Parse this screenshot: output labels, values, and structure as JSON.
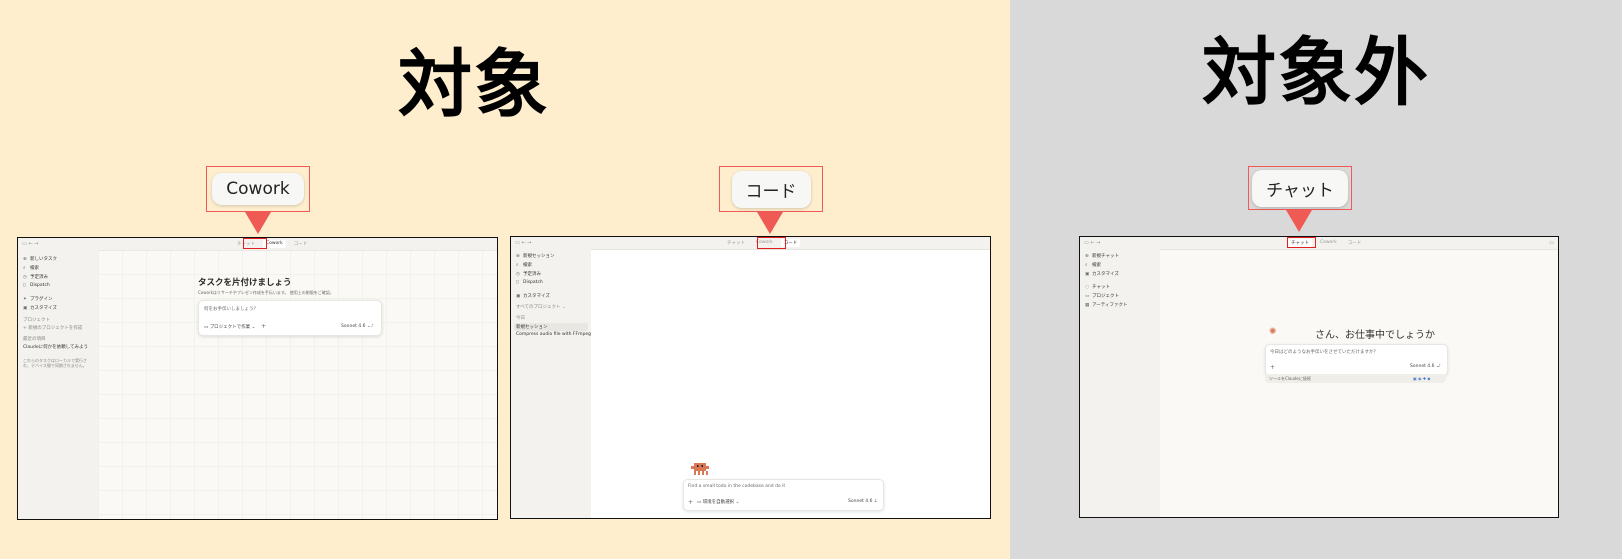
{
  "left_panel": {
    "title": "対象",
    "bg_color": "#FEEECE"
  },
  "right_panel": {
    "title": "対象外",
    "bg_color": "#D9D9D9"
  },
  "accent_color": "#F05A55",
  "tags": {
    "cowork": "Cowork",
    "code": "コード",
    "chat": "チャット"
  },
  "cowork_shot": {
    "tabs": [
      "チャット",
      "Cowork",
      "コード"
    ],
    "sidebar": {
      "items": [
        {
          "icon": "plus-icon",
          "label": "新しいタスク"
        },
        {
          "icon": "search-icon",
          "label": "検索"
        },
        {
          "icon": "clock-icon",
          "label": "予定済み"
        },
        {
          "icon": "dispatch-icon",
          "label": "Dispatch"
        },
        {
          "icon": "puzzle-icon",
          "label": "プラグイン"
        },
        {
          "icon": "customize-icon",
          "label": "カスタマイズ"
        }
      ],
      "projects_label": "プロジェクト",
      "new_project": "+ 新規のプロジェクトを作成",
      "recent_label": "最近の項目",
      "recent_item": "Claudeに何かを依頼してみよう",
      "footer_note": "これらのタスクはローカルで実行され、デバイス間で同期されません。"
    },
    "main": {
      "heading": "タスクを片付けましょう",
      "subheading": "Coworkはリサーチやプレゼン作成を手伝います。 使用上の制限をご確認。",
      "input_placeholder": "何をお手伝いしましょう？",
      "project_selector": "プロジェクトで作業",
      "model": "Sonnet 4.6"
    }
  },
  "code_shot": {
    "tabs": [
      "チャット",
      "Cowork",
      "コード"
    ],
    "sidebar": {
      "items": [
        {
          "icon": "plus-icon",
          "label": "新規セッション"
        },
        {
          "icon": "search-icon",
          "label": "検索"
        },
        {
          "icon": "clock-icon",
          "label": "予定済み"
        },
        {
          "icon": "dispatch-icon",
          "label": "Dispatch"
        },
        {
          "icon": "customize-icon",
          "label": "カスタマイズ"
        }
      ],
      "projects_label": "すべてのプロジェクト",
      "today_label": "今日",
      "sessions": [
        "新規セッション",
        "Compress audio file with FFmpeg"
      ]
    },
    "main": {
      "input_placeholder": "Find a small todo in the codebase and do it",
      "environment": "環境を自動選択",
      "model": "Sonnet 4.6"
    }
  },
  "chat_shot": {
    "tabs": [
      "チャット",
      "Cowork",
      "コード"
    ],
    "sidebar": {
      "items": [
        {
          "icon": "plus-icon",
          "label": "新規チャット"
        },
        {
          "icon": "search-icon",
          "label": "検索"
        },
        {
          "icon": "customize-icon",
          "label": "カスタマイズ"
        },
        {
          "icon": "chat-icon",
          "label": "チャット"
        },
        {
          "icon": "folder-icon",
          "label": "プロジェクト"
        },
        {
          "icon": "artifact-icon",
          "label": "アーティファクト"
        }
      ]
    },
    "main": {
      "greeting": "さん、お仕事中でしょうか",
      "input_placeholder": "今日はどのようなお手伝いをさせていただけますか？",
      "model": "Sonnet 4.6",
      "connect_tools": "ツールをClaudeに接続"
    }
  }
}
